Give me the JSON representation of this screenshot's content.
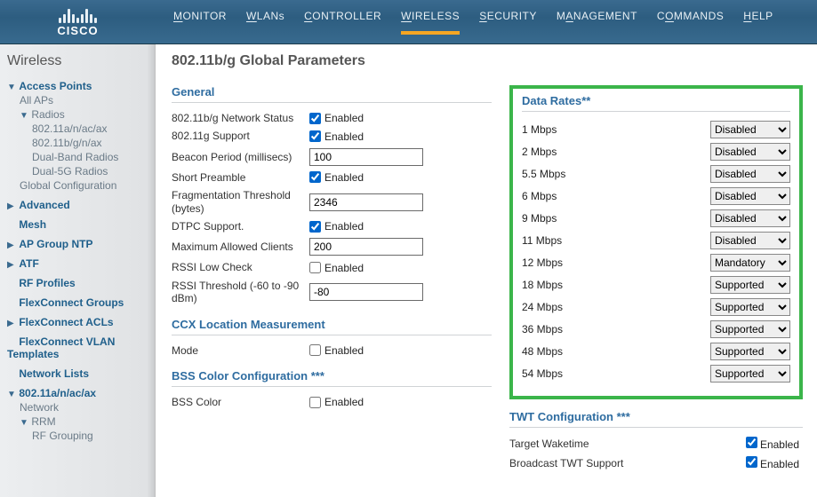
{
  "header": {
    "brand": "CISCO",
    "nav": {
      "monitor": "MONITOR",
      "wlans": "WLANs",
      "controller": "CONTROLLER",
      "wireless": "WIRELESS",
      "security": "SECURITY",
      "management": "MANAGEMENT",
      "commands": "COMMANDS",
      "help": "HELP"
    }
  },
  "sidebar": {
    "title": "Wireless",
    "items": {
      "access_points": "Access Points",
      "all_aps": "All APs",
      "radios": "Radios",
      "r_anacax": "802.11a/n/ac/ax",
      "r_bgnax": "802.11b/g/n/ax",
      "dual_band": "Dual-Band Radios",
      "dual_5g": "Dual-5G Radios",
      "global_config": "Global Configuration",
      "advanced": "Advanced",
      "mesh": "Mesh",
      "ap_group_ntp": "AP Group NTP",
      "atf": "ATF",
      "rf_profiles": "RF Profiles",
      "flexconnect_groups": "FlexConnect Groups",
      "flexconnect_acls": "FlexConnect ACLs",
      "flexconnect_vlan": "FlexConnect VLAN Templates",
      "network_lists": "Network Lists",
      "sec_anacax": "802.11a/n/ac/ax",
      "network": "Network",
      "rrm": "RRM",
      "rf_grouping": "RF Grouping"
    }
  },
  "page": {
    "title": "802.11b/g Global Parameters"
  },
  "general": {
    "title": "General",
    "network_status_label": "802.11b/g Network Status",
    "network_status_chk": "Enabled",
    "support_11g_label": "802.11g Support",
    "support_11g_chk": "Enabled",
    "beacon_label": "Beacon Period (millisecs)",
    "beacon_value": "100",
    "short_preamble_label": "Short Preamble",
    "short_preamble_chk": "Enabled",
    "frag_label": "Fragmentation Threshold (bytes)",
    "frag_value": "2346",
    "dtpc_label": "DTPC Support.",
    "dtpc_chk": "Enabled",
    "max_clients_label": "Maximum Allowed Clients",
    "max_clients_value": "200",
    "rssi_low_label": "RSSI Low Check",
    "rssi_low_chk": "Enabled",
    "rssi_thresh_label": "RSSI Threshold (-60 to -90 dBm)",
    "rssi_thresh_value": "-80"
  },
  "ccx": {
    "title": "CCX Location Measurement",
    "mode_label": "Mode",
    "mode_chk": "Enabled"
  },
  "bss": {
    "title": "BSS Color Configuration ***",
    "bss_color_label": "BSS Color",
    "bss_color_chk": "Enabled"
  },
  "datarates": {
    "title": "Data Rates**",
    "options": {
      "disabled": "Disabled",
      "mandatory": "Mandatory",
      "supported": "Supported"
    },
    "rows": [
      {
        "label": "1 Mbps",
        "value": "Disabled"
      },
      {
        "label": "2 Mbps",
        "value": "Disabled"
      },
      {
        "label": "5.5 Mbps",
        "value": "Disabled"
      },
      {
        "label": "6 Mbps",
        "value": "Disabled"
      },
      {
        "label": "9 Mbps",
        "value": "Disabled"
      },
      {
        "label": "11 Mbps",
        "value": "Disabled"
      },
      {
        "label": "12 Mbps",
        "value": "Mandatory"
      },
      {
        "label": "18 Mbps",
        "value": "Supported"
      },
      {
        "label": "24 Mbps",
        "value": "Supported"
      },
      {
        "label": "36 Mbps",
        "value": "Supported"
      },
      {
        "label": "48 Mbps",
        "value": "Supported"
      },
      {
        "label": "54 Mbps",
        "value": "Supported"
      }
    ]
  },
  "twt": {
    "title": "TWT Configuration ***",
    "target_waketime_label": "Target Waketime",
    "target_waketime_chk": "Enabled",
    "broadcast_label": "Broadcast TWT Support",
    "broadcast_chk": "Enabled"
  }
}
